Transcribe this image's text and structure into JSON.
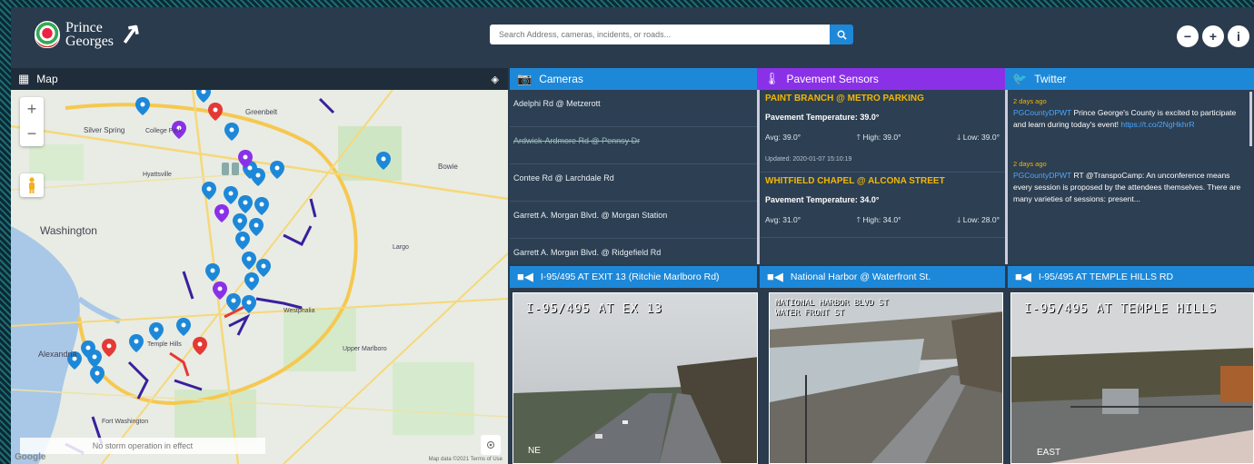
{
  "header": {
    "logo_line1": "Prince",
    "logo_line2": "Georges",
    "search_placeholder": "Search Address, cameras, incidents, or roads...",
    "buttons": [
      "−",
      "+",
      "i"
    ]
  },
  "map": {
    "title": "Map",
    "labels": [
      "Washington",
      "Alexandria",
      "Silver Spring",
      "College Park",
      "Hyattsville",
      "Greenbelt",
      "Upper Marlboro",
      "Westphalia",
      "Temple Hills",
      "Fort Washington",
      "Bowie",
      "Largo"
    ],
    "status": "No storm operation in effect",
    "credit": "Map data ©2021   Terms of Use",
    "google": "Google"
  },
  "cameras": {
    "title": "Cameras",
    "items": [
      {
        "label": "Adelphi Rd @ Metzerott",
        "struck": false
      },
      {
        "label": "Ardwick-Ardmore Rd @ Pennsy Dr",
        "struck": true
      },
      {
        "label": "Contee Rd @ Larchdale Rd",
        "struck": false
      },
      {
        "label": "Garrett A. Morgan Blvd. @ Morgan Station",
        "struck": false
      },
      {
        "label": "Garrett A. Morgan Blvd. @ Ridgefield Rd",
        "struck": false
      }
    ]
  },
  "pavement": {
    "title": "Pavement Sensors",
    "sensors": [
      {
        "name": "PAINT BRANCH @ METRO PARKING",
        "temp": "Pavement Temperature: 39.0°",
        "avg": "Avg: 39.0°",
        "high": "High: 39.0°",
        "low": "Low: 39.0°",
        "updated": "Updated: 2020-01-07 15:10:19"
      },
      {
        "name": "WHITFIELD CHAPEL @ ALCONA STREET",
        "temp": "Pavement Temperature: 34.0°",
        "avg": "Avg: 31.0°",
        "high": "High: 34.0°",
        "low": "Low: 28.0°",
        "updated": ""
      }
    ]
  },
  "twitter": {
    "title": "Twitter",
    "tweets": [
      {
        "time": "2 days ago",
        "handle": "PGCountyDPWT",
        "text": "Prince George's County is excited to participate and learn during today's event!",
        "link": "https://t.co/2NgHkhrR"
      },
      {
        "time": "2 days ago",
        "handle": "PGCountyDPWT",
        "text": "RT @TranspoCamp: An unconference means every session is proposed by the attendees themselves. There are many varieties of sessions: present...",
        "link": ""
      }
    ]
  },
  "videos": [
    {
      "title": "I-95/495 AT EXIT 13 (Ritchie Marlboro Rd)",
      "overlay": "I-95/495 AT EX 13",
      "corner": "NE"
    },
    {
      "title": "National Harbor @ Waterfront St.",
      "overlay": "NATIONAL HARBOR BLVD ST\nWATER FRONT ST",
      "corner": ""
    },
    {
      "title": "I-95/495 AT TEMPLE HILLS RD",
      "overlay": "I-95/495 AT TEMPLE HILLS",
      "corner": "EAST"
    }
  ],
  "colors": {
    "header_bg": "#2a3b4d",
    "blue": "#1e88d8",
    "purple": "#8a31e8",
    "yellow": "#f2b705"
  }
}
